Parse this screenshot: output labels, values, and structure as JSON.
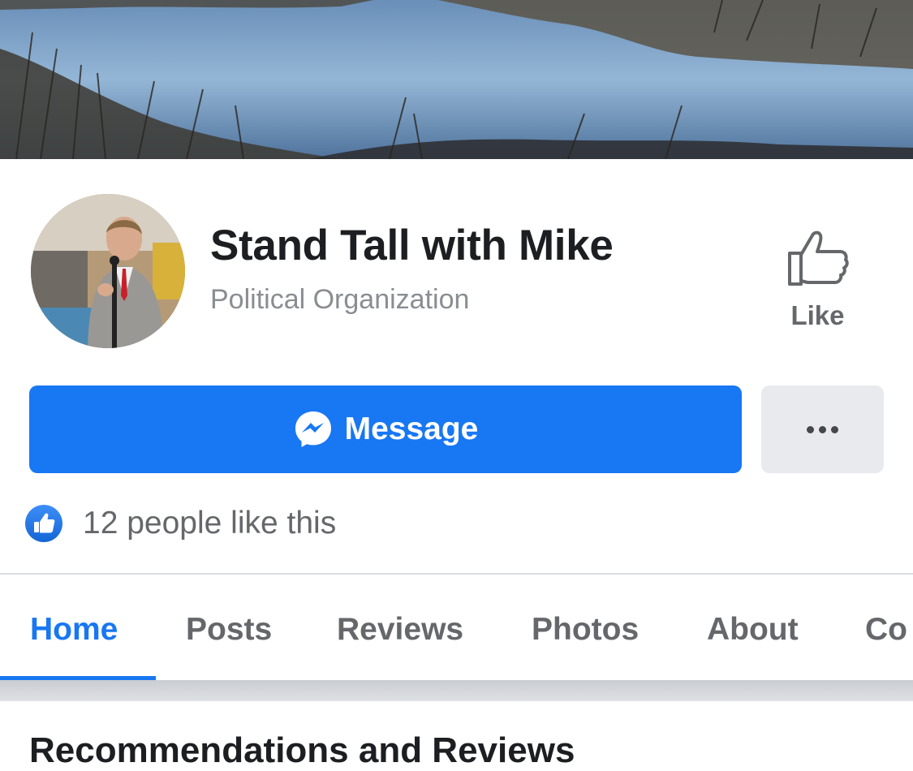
{
  "cover": {
    "description_icon": "cover-photo"
  },
  "profile": {
    "name": "Stand Tall with Mike",
    "category": "Political Organization",
    "avatar_icon": "profile-photo"
  },
  "like_button": {
    "label": "Like",
    "icon": "thumbs-up-outline-icon"
  },
  "actions": {
    "message_label": "Message",
    "message_icon": "messenger-icon",
    "more_icon": "more-dots-icon"
  },
  "likes": {
    "text": "12 people like this",
    "icon": "like-badge-icon"
  },
  "tabs": [
    {
      "label": "Home",
      "active": true
    },
    {
      "label": "Posts",
      "active": false
    },
    {
      "label": "Reviews",
      "active": false
    },
    {
      "label": "Photos",
      "active": false
    },
    {
      "label": "About",
      "active": false
    },
    {
      "label": "Co",
      "active": false
    }
  ],
  "section": {
    "heading": "Recommendations and Reviews"
  },
  "colors": {
    "accent": "#1877f2",
    "text_primary": "#1c1e21",
    "text_secondary": "#65676b",
    "button_gray": "#e9eaee"
  }
}
